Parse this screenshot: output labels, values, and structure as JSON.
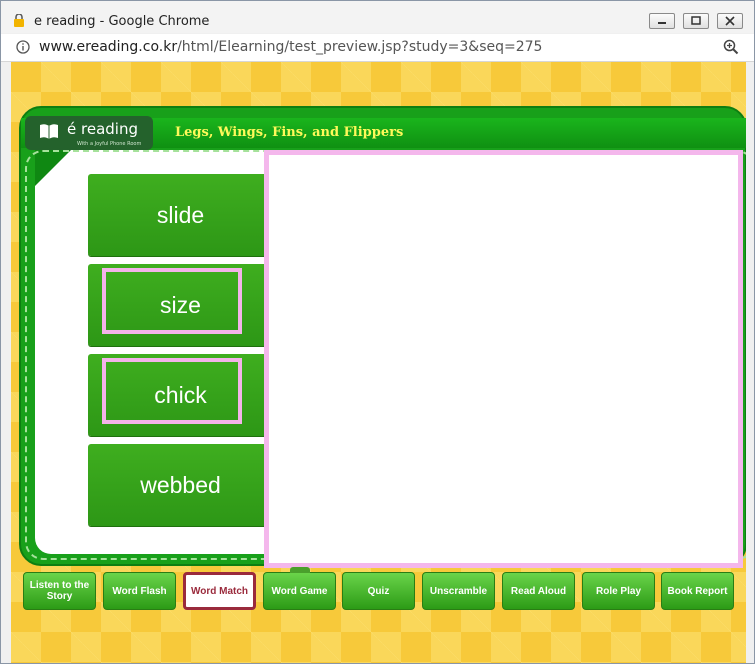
{
  "window": {
    "title": "e reading - Google Chrome",
    "url_domain": "www.ereading.co.kr",
    "url_path": "/html/Elearning/test_preview.jsp?study=3&seq=275"
  },
  "brand": {
    "logo_text": "é reading",
    "logo_sub": "With a Joyful Phone Room"
  },
  "lesson": {
    "title": "Legs, Wings, Fins, and Flippers"
  },
  "words": [
    {
      "label": "slide",
      "selected": false
    },
    {
      "label": "size",
      "selected": true
    },
    {
      "label": "chick",
      "selected": true
    },
    {
      "label": "webbed",
      "selected": false
    }
  ],
  "nav": [
    {
      "label": "Listen to the Story",
      "active": false
    },
    {
      "label": "Word Flash",
      "active": false
    },
    {
      "label": "Word Match",
      "active": true
    },
    {
      "label": "Word Game",
      "active": false
    },
    {
      "label": "Quiz",
      "active": false
    },
    {
      "label": "Unscramble",
      "active": false
    },
    {
      "label": "Read Aloud",
      "active": false
    },
    {
      "label": "Role Play",
      "active": false
    },
    {
      "label": "Book Report",
      "active": false
    }
  ],
  "colors": {
    "accent_green": "#18a01a",
    "selection_pink": "#f4b3ea",
    "title_yellow": "#fff95a",
    "active_maroon": "#9a2a3c"
  }
}
